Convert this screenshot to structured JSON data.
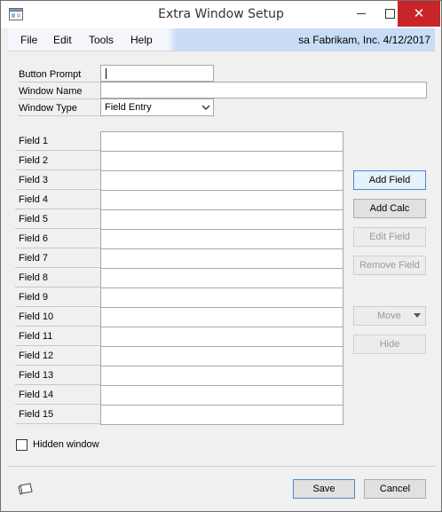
{
  "window": {
    "title": "Extra Window Setup",
    "close_glyph": "✕",
    "icons": {
      "app": "app-window-icon",
      "minimize": "minimize-icon",
      "maximize": "maximize-icon",
      "close": "close-icon"
    }
  },
  "menu": {
    "items": [
      "File",
      "Edit",
      "Tools",
      "Help"
    ],
    "user_info": "sa  Fabrikam, Inc.  4/12/2017"
  },
  "form": {
    "button_prompt_label": "Button Prompt",
    "button_prompt_value": "",
    "window_name_label": "Window Name",
    "window_name_value": "",
    "window_type_label": "Window Type",
    "window_type_value": "Field Entry"
  },
  "fields": [
    {
      "label": "Field 1",
      "value": ""
    },
    {
      "label": "Field 2",
      "value": ""
    },
    {
      "label": "Field 3",
      "value": ""
    },
    {
      "label": "Field 4",
      "value": ""
    },
    {
      "label": "Field 5",
      "value": ""
    },
    {
      "label": "Field 6",
      "value": ""
    },
    {
      "label": "Field 7",
      "value": ""
    },
    {
      "label": "Field 8",
      "value": ""
    },
    {
      "label": "Field 9",
      "value": ""
    },
    {
      "label": "Field 10",
      "value": ""
    },
    {
      "label": "Field 11",
      "value": ""
    },
    {
      "label": "Field 12",
      "value": ""
    },
    {
      "label": "Field 13",
      "value": ""
    },
    {
      "label": "Field 14",
      "value": ""
    },
    {
      "label": "Field 15",
      "value": ""
    }
  ],
  "side_buttons": {
    "add_field": "Add Field",
    "add_calc": "Add Calc",
    "edit_field": "Edit Field",
    "remove_field": "Remove Field",
    "move": "Move",
    "hide": "Hide"
  },
  "hidden_window": {
    "label": "Hidden window",
    "checked": false
  },
  "footer": {
    "note_icon": "note-icon",
    "save": "Save",
    "cancel": "Cancel"
  },
  "colors": {
    "close_button": "#c7252a",
    "menubar_accent": "#c8dcf6",
    "focus_border": "#4a88d8"
  }
}
